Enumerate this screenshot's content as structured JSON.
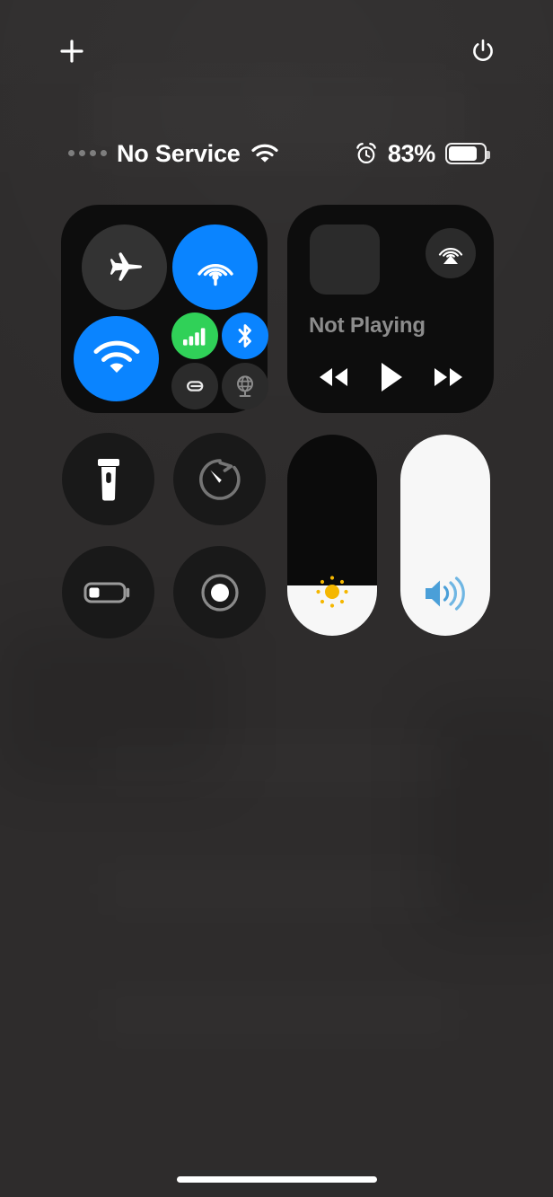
{
  "theme": {
    "accent_blue": "#0a84ff",
    "accent_green": "#30d158",
    "slider_fill": "#f7f7f7",
    "brightness_icon": "#f5b700",
    "volume_icon": "#4a9fd8",
    "module_bg": "#0d0d0d",
    "toggle_off_bg": "#333333",
    "backdrop": "#2e2c2c"
  },
  "top_bar": {
    "add_label": "add-controls",
    "add_icon": "plus-icon",
    "power_label": "power",
    "power_icon": "power-icon"
  },
  "status_bar": {
    "signal_icon": "cellular-dots-icon",
    "carrier": "No Service",
    "wifi_icon": "wifi-icon",
    "alarm_icon": "alarm-clock-icon",
    "battery_percent": "83%",
    "battery_level": 83,
    "battery_icon": "battery-full-icon"
  },
  "connectivity": {
    "name": "connectivity-module",
    "toggles": [
      {
        "key": "airplane",
        "label": "Airplane Mode",
        "icon": "airplane-icon",
        "state": "off"
      },
      {
        "key": "airdrop",
        "label": "AirDrop",
        "icon": "airdrop-icon",
        "state": "on"
      },
      {
        "key": "wifi",
        "label": "Wi-Fi",
        "icon": "wifi-icon",
        "state": "on"
      },
      {
        "key": "cellular",
        "label": "Cellular Data",
        "icon": "cellular-bars-icon",
        "state": "on"
      },
      {
        "key": "bluetooth",
        "label": "Bluetooth",
        "icon": "bluetooth-icon",
        "state": "on"
      },
      {
        "key": "hotspot",
        "label": "Personal Hotspot",
        "icon": "hotspot-link-icon",
        "state": "off"
      },
      {
        "key": "vpn",
        "label": "VPN",
        "icon": "globe-satellite-icon",
        "state": "off"
      }
    ]
  },
  "media": {
    "name": "now-playing-module",
    "artwork_label": "album-artwork-placeholder",
    "status": "Not Playing",
    "airplay_icon": "airplay-audio-icon",
    "controls": [
      {
        "key": "rewind",
        "label": "Rewind",
        "icon": "rewind-icon"
      },
      {
        "key": "play",
        "label": "Play",
        "icon": "play-icon"
      },
      {
        "key": "forward",
        "label": "Fast Forward",
        "icon": "fast-forward-icon"
      }
    ]
  },
  "buttons": [
    {
      "key": "flashlight",
      "label": "Flashlight",
      "icon": "flashlight-icon",
      "state": "off"
    },
    {
      "key": "timer",
      "label": "Timer",
      "icon": "timer-icon",
      "state": "off"
    },
    {
      "key": "low_power",
      "label": "Low Power Mode",
      "icon": "battery-low-icon",
      "state": "off"
    },
    {
      "key": "screen_record",
      "label": "Screen Recording",
      "icon": "screen-record-icon",
      "state": "off"
    }
  ],
  "sliders": {
    "brightness": {
      "label": "Brightness",
      "icon": "brightness-sun-icon",
      "value": 25
    },
    "volume": {
      "label": "Volume",
      "icon": "speaker-waves-icon",
      "value": 100
    }
  },
  "home_indicator": {
    "label": "home-indicator"
  }
}
